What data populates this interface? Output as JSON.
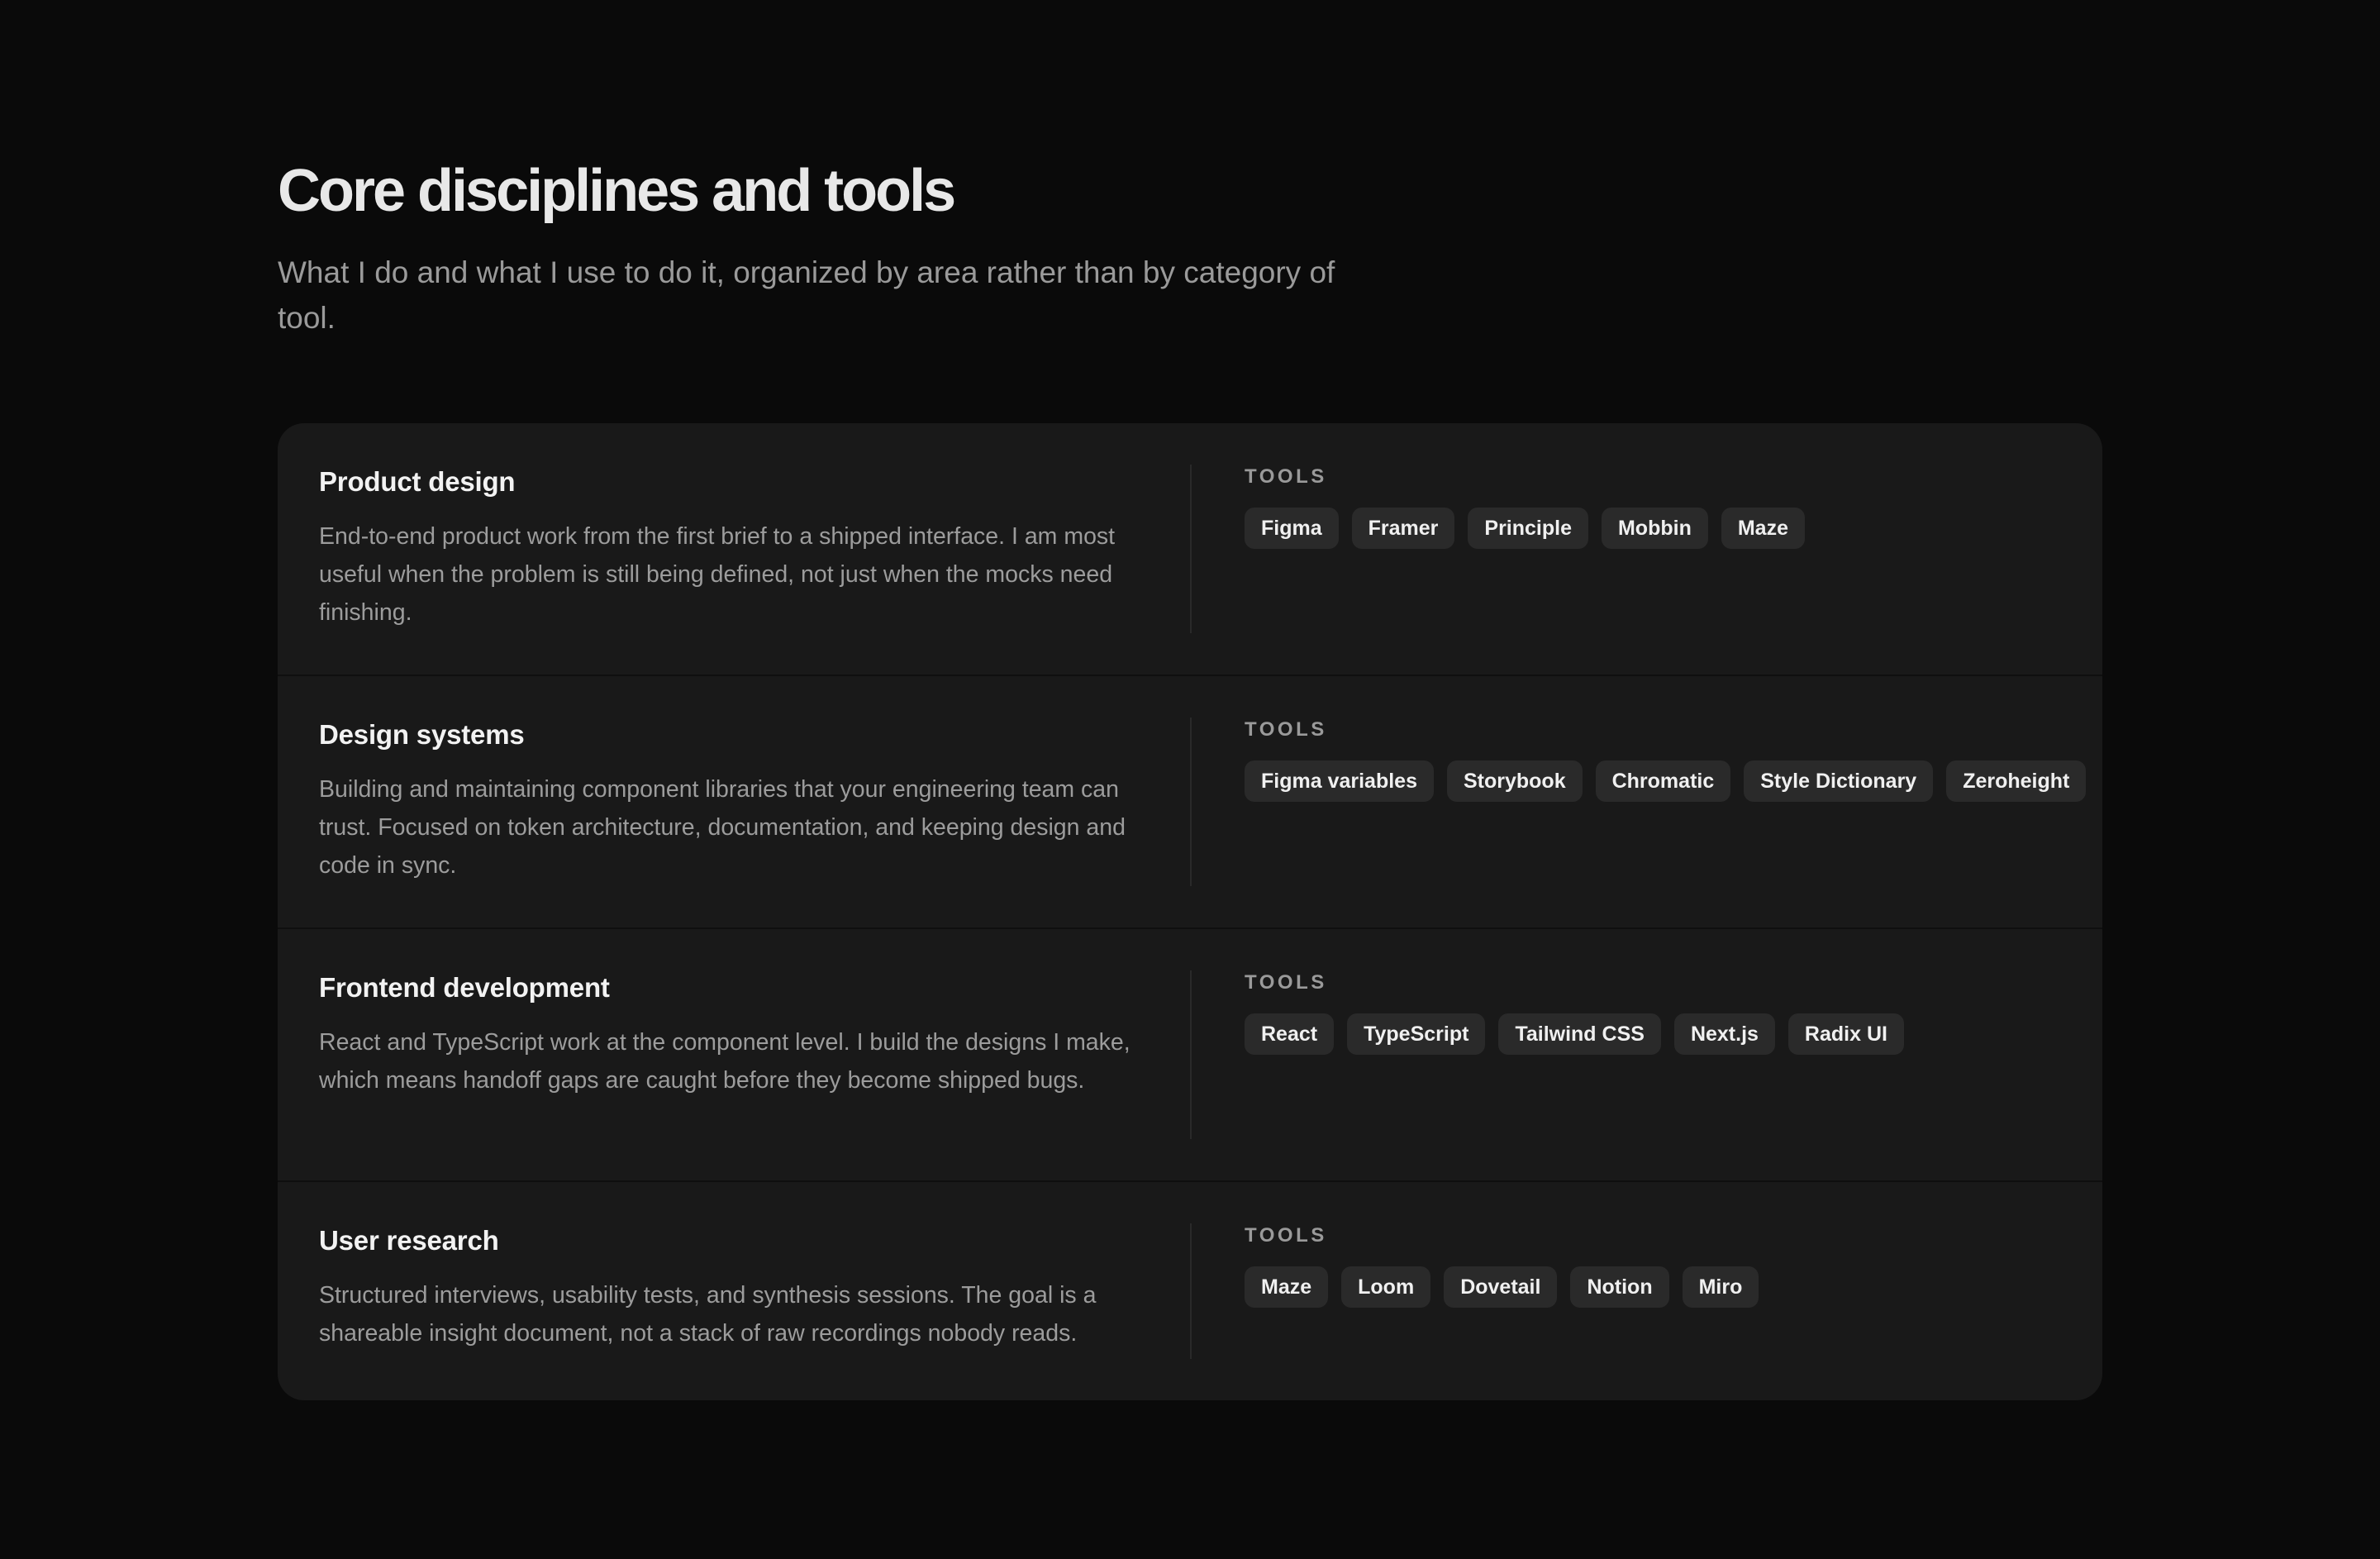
{
  "header": {
    "title": "Core disciplines and tools",
    "subtitle": "What I do and what I use to do it, organized by area rather than by category of tool."
  },
  "tools_label": "TOOLS",
  "disciplines": [
    {
      "title": "Product design",
      "description": "End-to-end product work from the first brief to a shipped interface. I am most useful when the problem is still being defined, not just when the mocks need finishing.",
      "tools": [
        "Figma",
        "Framer",
        "Principle",
        "Mobbin",
        "Maze"
      ]
    },
    {
      "title": "Design systems",
      "description": "Building and maintaining component libraries that your engineering team can trust. Focused on token architecture, documentation, and keeping design and code in sync.",
      "tools": [
        "Figma variables",
        "Storybook",
        "Chromatic",
        "Style Dictionary",
        "Zeroheight"
      ]
    },
    {
      "title": "Frontend development",
      "description": "React and TypeScript work at the component level. I build the designs I make, which means handoff gaps are caught before they become shipped bugs.",
      "tools": [
        "React",
        "TypeScript",
        "Tailwind CSS",
        "Next.js",
        "Radix UI"
      ]
    },
    {
      "title": "User research",
      "description": "Structured interviews, usability tests, and synthesis sessions. The goal is a shareable insight document, not a stack of raw recordings nobody reads.",
      "tools": [
        "Maze",
        "Loom",
        "Dovetail",
        "Notion",
        "Miro"
      ]
    }
  ]
}
